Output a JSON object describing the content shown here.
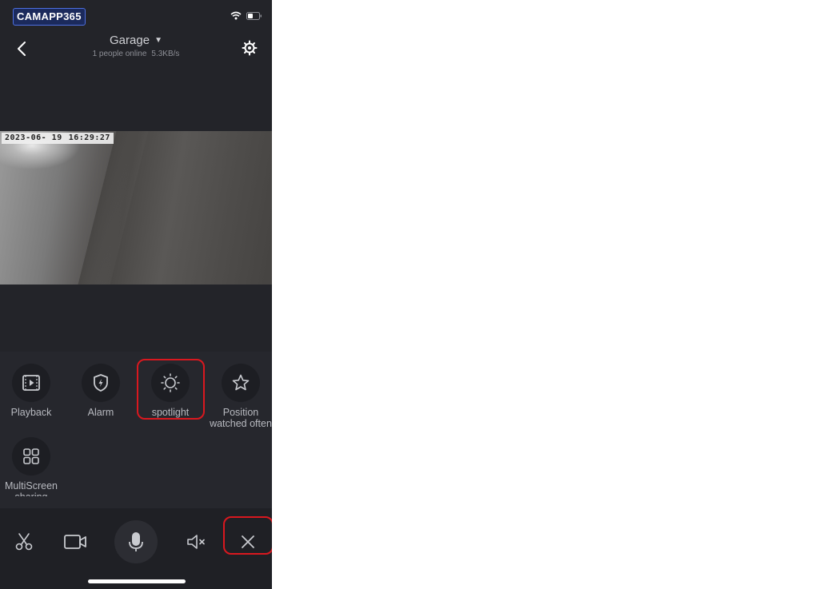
{
  "status_bar": {
    "app_logo": "CAMAPP365",
    "icons": [
      "wifi-icon",
      "battery-icon"
    ]
  },
  "header": {
    "title": "Garage",
    "online": "1 people online",
    "speed": "5.3KB/s",
    "icons": [
      "back-arrow-icon",
      "dropdown-caret-icon",
      "settings-gear-icon"
    ]
  },
  "video": {
    "date": "2023-06- 19",
    "time": "16:29:27"
  },
  "functions": [
    {
      "label": "Playback",
      "icon": "playback-icon"
    },
    {
      "label": "Alarm",
      "icon": "alarm-shield-icon"
    },
    {
      "label": "spotlight",
      "icon": "spotlight-sun-icon"
    },
    {
      "label": "Position watched often",
      "icon": "star-icon"
    },
    {
      "label": "MultiScreen sharing",
      "icon": "multiscreen-grid-icon"
    }
  ],
  "toolbar": {
    "icons": [
      "scissors-icon",
      "video-record-icon",
      "microphone-icon",
      "mute-speaker-icon",
      "close-icon"
    ]
  },
  "highlight_color": "#d9181f"
}
